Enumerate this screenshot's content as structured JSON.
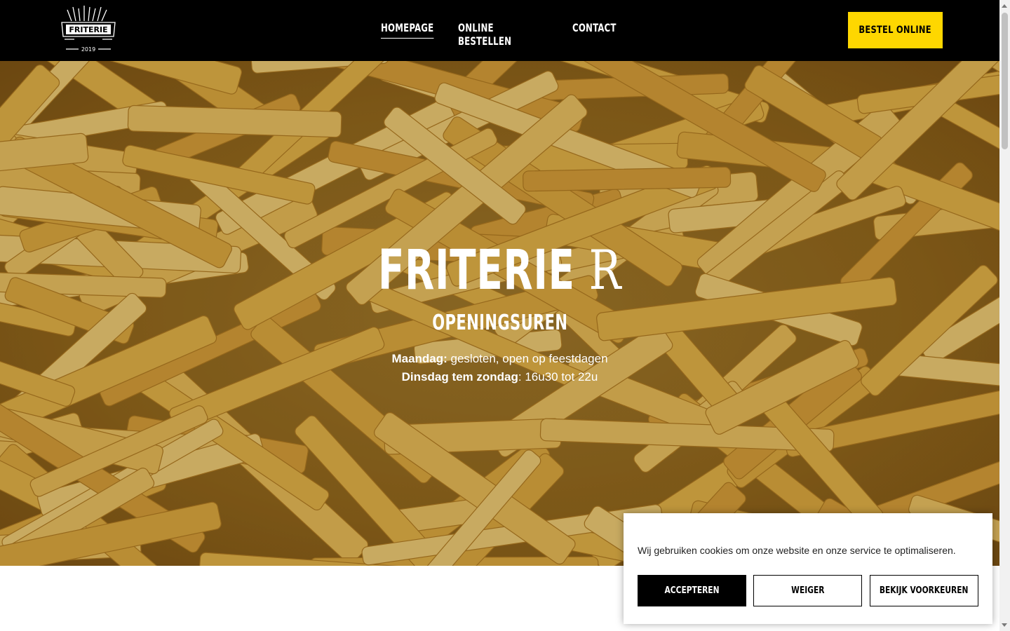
{
  "header": {
    "logo": {
      "word": "FRITERIE",
      "year": "2019",
      "icon": "fries-box-logo"
    },
    "nav": [
      {
        "label": "HOMEPAGE",
        "active": true
      },
      {
        "label": "ONLINE BESTELLEN",
        "active": false
      },
      {
        "label": "CONTACT",
        "active": false
      }
    ],
    "cta_label": "BESTEL ONLINE",
    "cta_color": "#fed700"
  },
  "hero": {
    "title_main": "FRITERIE",
    "title_letter": "R",
    "subtitle": "OPENINGSUREN",
    "hours": [
      {
        "day": "Maandag:",
        "text": " gesloten, open op feestdagen"
      },
      {
        "day": "Dinsdag tem zondag",
        "text": ": 16u30 tot 22u"
      }
    ]
  },
  "cookie": {
    "text": "Wij gebruiken cookies om onze website en onze service te optimaliseren.",
    "accept_label": "ACCEPTEREN",
    "deny_label": "WEIGER",
    "prefs_label": "BEKIJK VOORKEUREN"
  }
}
